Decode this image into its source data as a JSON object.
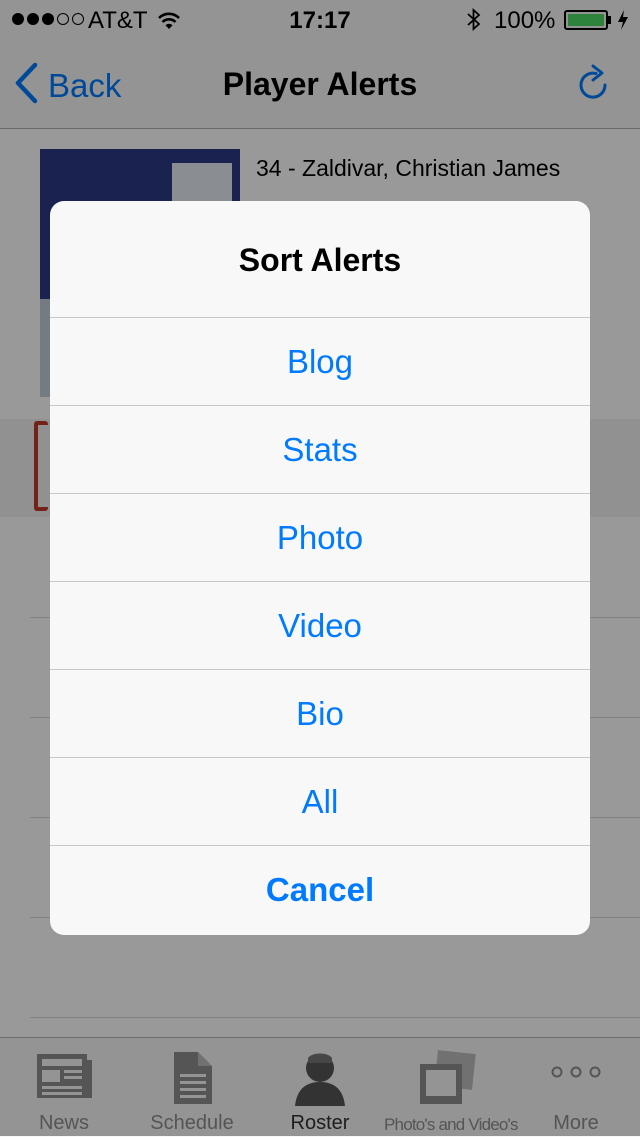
{
  "status_bar": {
    "carrier": "AT&T",
    "time": "17:17",
    "battery": "100%",
    "signal_bars": 3,
    "signal_total": 5
  },
  "nav": {
    "back_label": "Back",
    "title": "Player Alerts"
  },
  "content": {
    "player_name": "34 - Zaldivar, Christian James"
  },
  "tabs": [
    {
      "label": "News",
      "icon": "newspaper-icon"
    },
    {
      "label": "Schedule",
      "icon": "document-icon"
    },
    {
      "label": "Roster",
      "icon": "person-icon"
    },
    {
      "label": "Photo's and Video's",
      "icon": "photos-icon"
    },
    {
      "label": "More",
      "icon": "more-dots-icon"
    }
  ],
  "sheet": {
    "title": "Sort Alerts",
    "options": [
      "Blog",
      "Stats",
      "Photo",
      "Video",
      "Bio",
      "All"
    ],
    "cancel": "Cancel"
  },
  "colors": {
    "accent": "#007aff",
    "battery": "#4cd964",
    "overlay": "rgba(0,0,0,0.40)"
  }
}
